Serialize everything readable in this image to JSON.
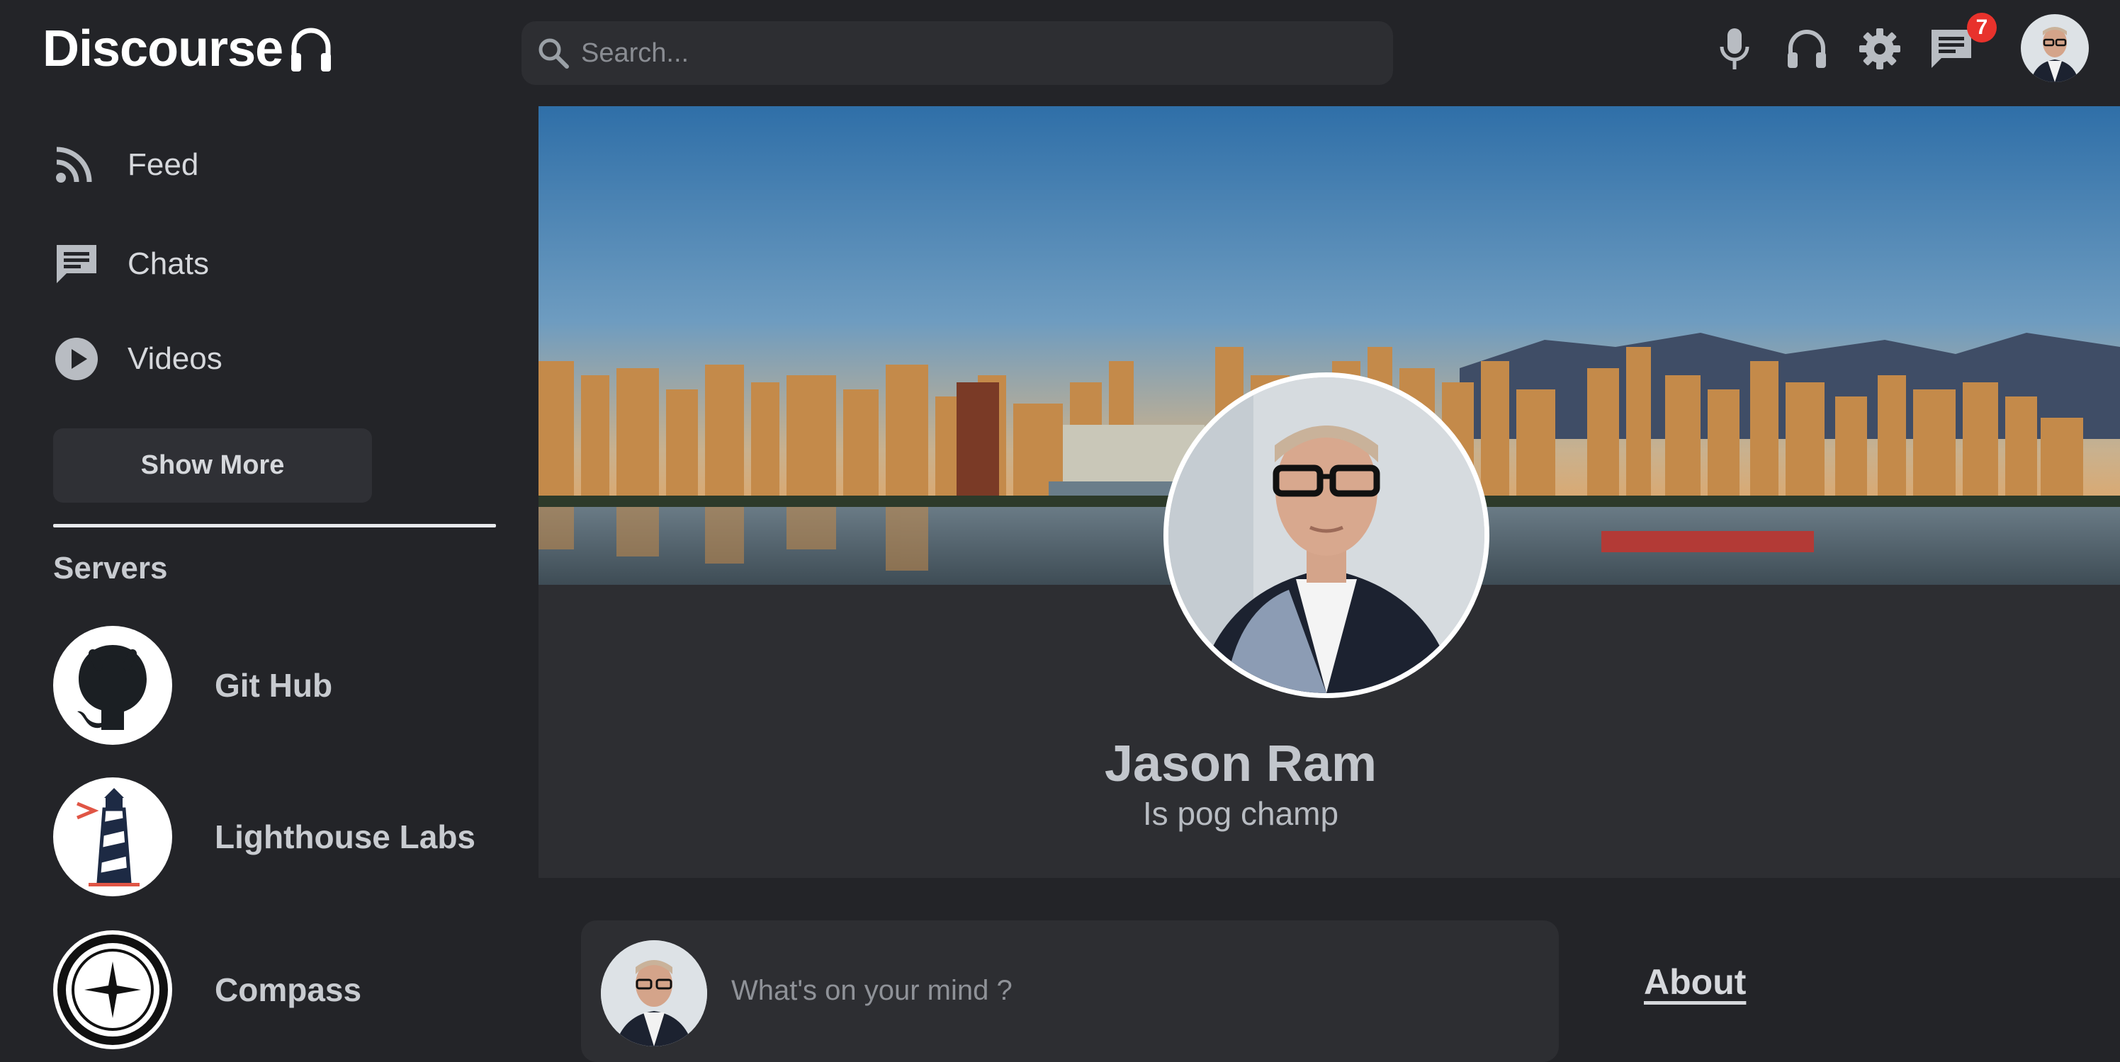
{
  "app": {
    "title": "Discourse"
  },
  "search": {
    "placeholder": "Search..."
  },
  "topbar": {
    "icons": [
      "microphone-icon",
      "headphones-icon",
      "gear-icon",
      "chat-icon"
    ],
    "notification_count": "7"
  },
  "sidebar": {
    "items": [
      {
        "label": "Feed",
        "icon": "rss-icon"
      },
      {
        "label": "Chats",
        "icon": "chat-icon"
      },
      {
        "label": "Videos",
        "icon": "play-icon"
      }
    ],
    "show_more_label": "Show More",
    "servers_heading": "Servers",
    "servers": [
      {
        "name": "Git Hub",
        "icon": "github-icon"
      },
      {
        "name": "Lighthouse Labs",
        "icon": "lighthouse-icon"
      },
      {
        "name": "Compass",
        "icon": "compass-icon"
      }
    ]
  },
  "profile": {
    "name": "Jason Ram",
    "bio": "Is pog champ"
  },
  "post": {
    "placeholder": "What's on your mind ?"
  },
  "about": {
    "label": "About"
  },
  "colors": {
    "background": "#232428",
    "panel": "#2d2e32",
    "badge": "#e8322c",
    "text": "#d6d8dc"
  }
}
